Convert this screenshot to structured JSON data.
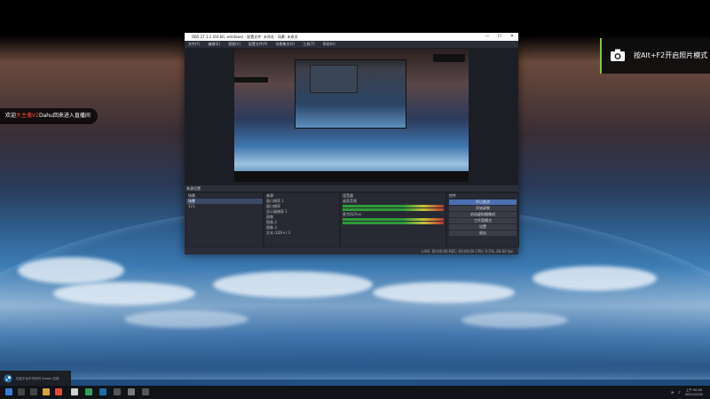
{
  "overlay": {
    "welcome_prefix": "欢迎",
    "welcome_highlight": "大主播V2",
    "welcome_suffix": "Dahu回来进入直播间",
    "hint_text": "按Alt+F2开启照片模式"
  },
  "obs": {
    "title": "OBS 27.1.1 (64-bit, windows) - 配置文件: 未命名 - 场景: 未命名",
    "window_controls": [
      "—",
      "☐",
      "✕"
    ],
    "menu": [
      "文件(F)",
      "编辑(E)",
      "视图(V)",
      "配置文件(P)",
      "场景集合(S)",
      "工具(T)",
      "帮助(H)"
    ],
    "docks_header": "来源设置",
    "scenes_header": "场景",
    "scenes": [
      "场景",
      "123"
    ],
    "sources_header": "来源",
    "sources": [
      "窗口捕获 1",
      "窗口捕获",
      "显示器捕获 1",
      "图像",
      "图像 2",
      "图像 3",
      "文本 (GDI+) 3",
      "图像 4",
      "图像 5"
    ],
    "mixer_header": "混音器",
    "mixer_tracks": [
      "桌面音频",
      "麦克风/Aux"
    ],
    "controls_header": "控件",
    "controls": [
      "停止推流",
      "开始录制",
      "启动虚拟摄像机",
      "工作室模式",
      "设置",
      "退出"
    ],
    "status": "LIVE: 00:00:00  REC: 00:00:00  CPU: 0.5%, 60.00 fps"
  },
  "taskbar": {
    "toast": "在此平台中可访问 Steam 应用",
    "time": "上午 00:00",
    "date": "2021/12/02"
  },
  "colors": {
    "accent": "#7ad12a",
    "highlight": "#ff4a3a",
    "obs_bg": "#2b2e38"
  }
}
